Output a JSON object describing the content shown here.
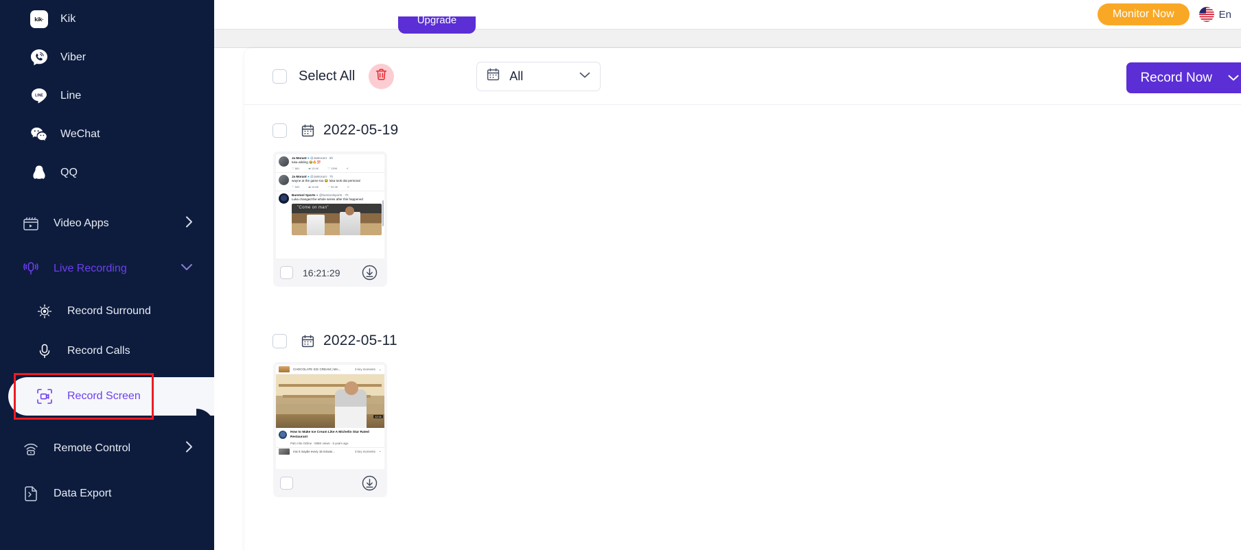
{
  "sidebar": {
    "apps": [
      {
        "label": "Kik",
        "icon": "kik-icon",
        "glyph": "kik"
      },
      {
        "label": "Viber",
        "icon": "viber-icon",
        "glyph": "viber"
      },
      {
        "label": "Line",
        "icon": "line-icon",
        "glyph": "LINE"
      },
      {
        "label": "WeChat",
        "icon": "wechat-icon",
        "glyph": "wechat"
      },
      {
        "label": "QQ",
        "icon": "qq-icon",
        "glyph": "qq"
      }
    ],
    "video_apps": {
      "label": "Video Apps",
      "icon": "video-apps-icon",
      "chevron": "chevron-right-icon"
    },
    "live_recording": {
      "label": "Live Recording",
      "icon": "live-recording-icon",
      "chevron": "chevron-down-icon"
    },
    "live_children": [
      {
        "label": "Record Surround",
        "icon": "record-surround-icon"
      },
      {
        "label": "Record Calls",
        "icon": "record-calls-icon"
      }
    ],
    "record_screen": {
      "label": "Record Screen",
      "icon": "record-screen-icon"
    },
    "remote_control": {
      "label": "Remote Control",
      "icon": "remote-control-icon",
      "chevron": "chevron-right-icon"
    },
    "data_export": {
      "label": "Data Export",
      "icon": "data-export-icon"
    }
  },
  "topbar": {
    "monitor_label": "Monitor Now",
    "flag": "us-flag-icon",
    "language": "En",
    "cut_button_label": "Upgrade"
  },
  "toolbar": {
    "select_all_label": "Select All",
    "delete_icon": "trash-icon",
    "date_filter": {
      "icon": "calendar-icon",
      "value": "All",
      "chevron": "chevron-down-icon"
    },
    "record_now_label": "Record Now",
    "record_now_chevron": "chevron-down-icon"
  },
  "groups": [
    {
      "date": "2022-05-19",
      "calendar_icon": "calendar-icon",
      "items": [
        {
          "time": "16:21:29",
          "download_icon": "download-icon",
          "thumbnail_kind": "twitter-feed",
          "tweets": [
            {
              "name": "Ja Morant",
              "verified": true,
              "handle": "@JaMorant",
              "age": "8h",
              "text": "luka wilding 😂🔥💯",
              "replies": "661",
              "retweets": "13.4K",
              "likes": "139K"
            },
            {
              "name": "Ja Morant",
              "verified": true,
              "handle": "@JaMorant",
              "age": "7h",
              "text": "wayne at the game too 😂 luka took dat personal",
              "replies": "520",
              "retweets": "10.8K",
              "likes": "99.3K"
            },
            {
              "name": "Barstool Sports",
              "verified": true,
              "handle": "@barstoolsports",
              "age": "7h",
              "text": "Luka changed the whole series after this happened",
              "media_caption": "\"Come on man\""
            }
          ]
        }
      ]
    },
    {
      "date": "2022-05-11",
      "calendar_icon": "calendar-icon",
      "items": [
        {
          "time": "",
          "download_icon": "download-icon",
          "thumbnail_kind": "youtube-video",
          "video": {
            "top_chapter_title": "CHOCOLATE ICE CREAM | MA...",
            "top_key_moments": "3 key moments",
            "title": "How to Make Ice Cream Like A Michelin Star Rated Restaurant",
            "meta": "Palo Alto Online · 596K views · 5 years ago",
            "duration": "12:11",
            "bottom_chapter_title": "mix it maybe every 15 minute...",
            "bottom_key_moments": "3 key moments"
          }
        }
      ]
    }
  ],
  "colors": {
    "sidebar_bg": "#0d1c3d",
    "accent_purple": "#5b2ed6",
    "accent_light_purple": "#6d3ff0",
    "monitor_orange": "#f9a825",
    "danger_red": "#e53935",
    "highlight_box": "#ec1c24"
  }
}
